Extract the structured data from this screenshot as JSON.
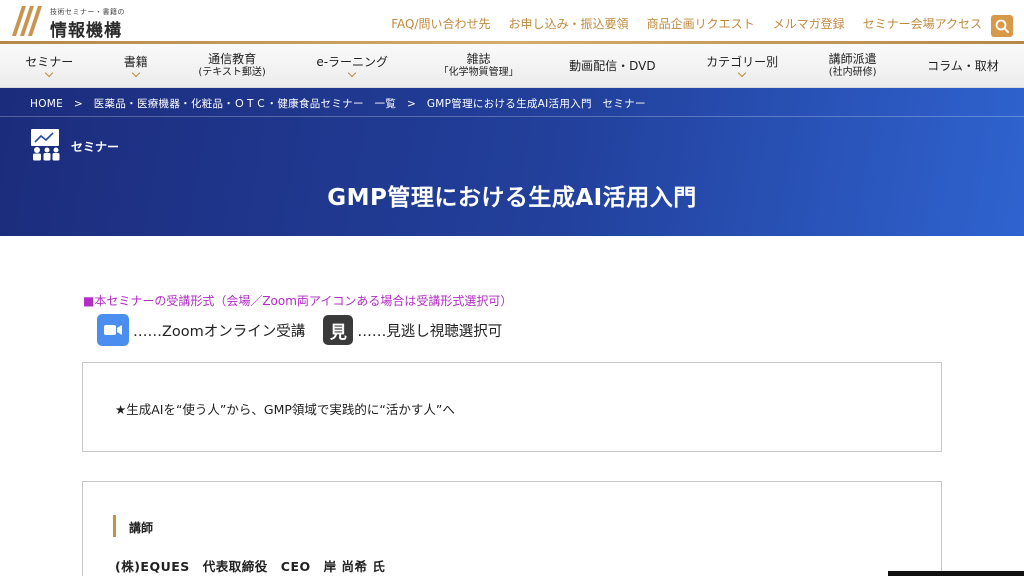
{
  "header": {
    "logo_small": "技術セミナー・書籍の",
    "logo_main": "情報機構",
    "links": [
      "FAQ/問い合わせ先",
      "お申し込み・振込要領",
      "商品企画リクエスト",
      "メルマガ登録",
      "セミナー会場アクセス"
    ],
    "brand_color": "#c08a3e"
  },
  "nav": {
    "items": [
      {
        "label": "セミナー",
        "sub": ""
      },
      {
        "label": "書籍",
        "sub": ""
      },
      {
        "label": "通信教育",
        "sub": "(テキスト郵送)"
      },
      {
        "label": "e-ラーニング",
        "sub": ""
      },
      {
        "label": "雑誌",
        "sub": "「化学物質管理」"
      },
      {
        "label": "動画配信・DVD",
        "sub": ""
      },
      {
        "label": "カテゴリー別",
        "sub": ""
      },
      {
        "label": "講師派遣",
        "sub": "(社内研修)"
      },
      {
        "label": "コラム・取材",
        "sub": ""
      }
    ]
  },
  "hero": {
    "breadcrumb": "HOME　>　医薬品・医療機器・化粧品・ＯＴＣ・健康食品セミナー　一覧　>　GMP管理における生成AI活用入門　セミナー",
    "category": "セミナー",
    "title": "GMP管理における生成AI活用入門"
  },
  "format": {
    "heading": "■本セミナーの受講形式（会場／Zoom両アイコンある場合は受講形式選択可）",
    "zoom_text": "……Zoomオンライン受講",
    "mi_char": "見",
    "mi_text": "……見逃し視聴選択可"
  },
  "catch": "★生成AIを“使う人”から、GMP領域で実践的に“活かす人”へ",
  "lecturer": {
    "heading": "講師",
    "name": "(株)EQUES　代表取締役　CEO　岸 尚希 氏"
  }
}
